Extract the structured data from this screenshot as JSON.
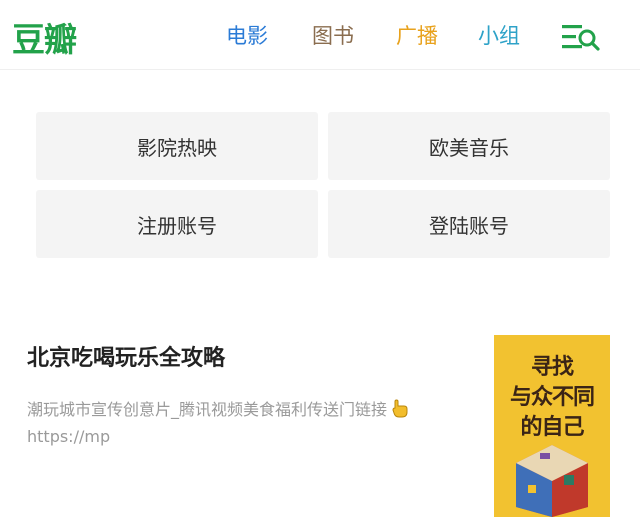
{
  "header": {
    "logo": "豆瓣",
    "nav": {
      "movie": "电影",
      "book": "图书",
      "radio": "广播",
      "group": "小组"
    },
    "menu_icon": "menu-search-icon",
    "colors": {
      "logo": "#22a24a",
      "movie": "#2b7bd6",
      "book": "#8a6d4f",
      "radio": "#e8a21d",
      "group": "#2ea2c8"
    }
  },
  "tiles": {
    "cinema": "影院热映",
    "music": "欧美音乐",
    "register": "注册账号",
    "login": "登陆账号"
  },
  "ad": {
    "title": "北京吃喝玩乐全攻略",
    "description": "潮玩城市宣传创意片_腾讯视频美食福利传送门链接",
    "link_text": "https://mp",
    "link_icon": "pointing-finger-icon",
    "poster_lines": [
      "寻找",
      "与众不同",
      "的自己"
    ]
  }
}
